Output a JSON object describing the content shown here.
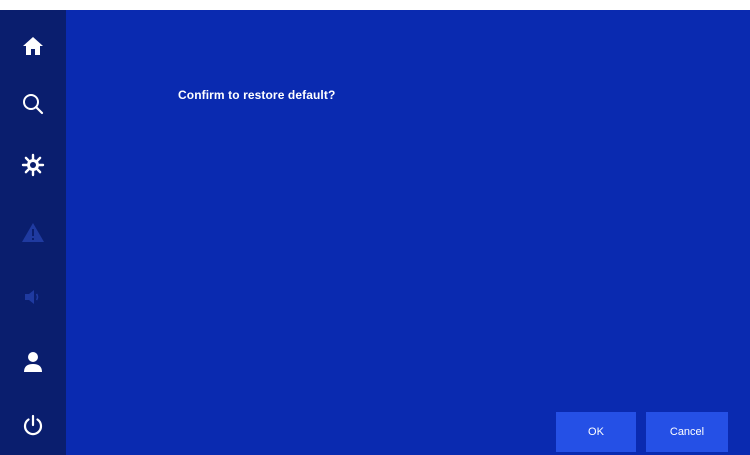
{
  "dialog": {
    "message": "Confirm to restore default?",
    "ok_label": "OK",
    "cancel_label": "Cancel"
  },
  "sidebar": {
    "items": [
      {
        "icon": "home-icon",
        "active": true
      },
      {
        "icon": "search-icon",
        "active": true
      },
      {
        "icon": "settings-icon",
        "active": true
      },
      {
        "icon": "warning-icon",
        "active": false
      },
      {
        "icon": "speaker-icon",
        "active": false
      },
      {
        "icon": "user-icon",
        "active": true
      },
      {
        "icon": "power-icon",
        "active": true
      }
    ]
  },
  "colors": {
    "sidebar_bg": "#0a1e6e",
    "main_bg": "#0a2ab0",
    "button_bg": "#2550e6",
    "icon_active": "#ffffff",
    "icon_inactive": "#1f3aa0"
  }
}
